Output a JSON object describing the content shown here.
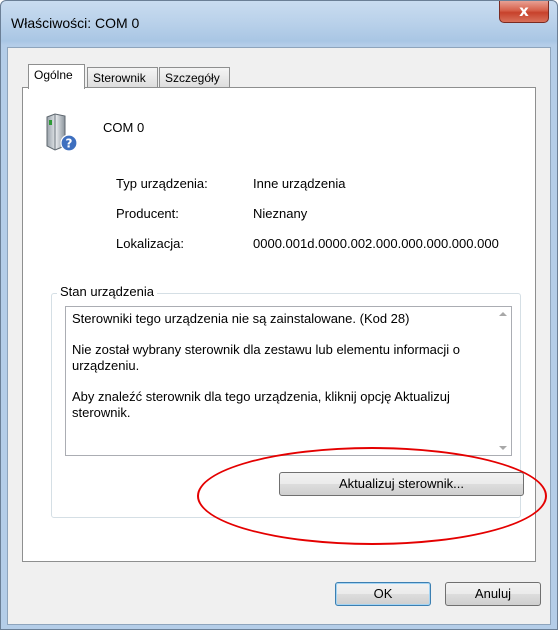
{
  "window": {
    "title": "Właściwości: COM 0",
    "close_symbol": "x"
  },
  "tabs": [
    {
      "label": "Ogólne",
      "active": true
    },
    {
      "label": "Sterownik",
      "active": false
    },
    {
      "label": "Szczegóły",
      "active": false
    }
  ],
  "device": {
    "name": "COM 0",
    "icon": "unknown-device-icon",
    "properties": [
      {
        "label": "Typ urządzenia:",
        "value": "Inne urządzenia"
      },
      {
        "label": "Producent:",
        "value": "Nieznany"
      },
      {
        "label": "Lokalizacja:",
        "value": "0000.001d.0000.002.000.000.000.000.000"
      }
    ]
  },
  "status": {
    "legend": "Stan urządzenia",
    "paragraphs": [
      "Sterowniki tego urządzenia nie są zainstalowane. (Kod 28)",
      "Nie został wybrany sterownik dla zestawu lub elementu informacji o urządzeniu.",
      "Aby znaleźć sterownik dla tego urządzenia, kliknij opcję Aktualizuj sterownik."
    ]
  },
  "buttons": {
    "update_driver": "Aktualizuj sterownik...",
    "ok": "OK",
    "cancel": "Anuluj"
  },
  "colors": {
    "annotation_ellipse": "#e40000",
    "close_button": "#c7412b"
  }
}
